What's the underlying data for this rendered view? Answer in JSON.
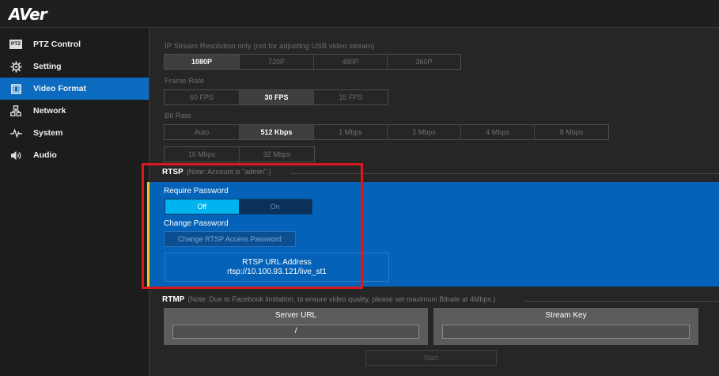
{
  "header": {
    "logo": "AVer"
  },
  "sidebar": {
    "items": [
      {
        "label": "PTZ Control",
        "icon": "ptz-icon",
        "badge": "PTZ"
      },
      {
        "label": "Setting",
        "icon": "gear-icon"
      },
      {
        "label": "Video Format",
        "icon": "film-icon"
      },
      {
        "label": "Network",
        "icon": "network-icon"
      },
      {
        "label": "System",
        "icon": "pulse-icon"
      },
      {
        "label": "Audio",
        "icon": "speaker-icon"
      }
    ],
    "active": "Video Format"
  },
  "resolution": {
    "label": "IP Stream Resolution only (not for adjusting USB video stream)",
    "options": [
      "1080P",
      "720P",
      "480P",
      "360P"
    ],
    "selected": "1080P"
  },
  "frame_rate": {
    "label": "Frame Rate",
    "options": [
      "60 FPS",
      "30 FPS",
      "15 FPS"
    ],
    "selected": "30 FPS"
  },
  "bit_rate": {
    "label": "Bit Rate",
    "row1": [
      "Auto",
      "512 Kbps",
      "1 Mbps",
      "2 Mbps",
      "4 Mbps",
      "8 Mbps"
    ],
    "row2": [
      "16 Mbps",
      "32 Mbps"
    ],
    "selected": "512 Kbps"
  },
  "rtsp": {
    "title": "RTSP",
    "note": "(Note: Account is \"admin\".)",
    "require_password_label": "Require Password",
    "toggle": {
      "off": "Off",
      "on": "On",
      "selected": "Off"
    },
    "change_password_label": "Change Password",
    "change_password_button": "Change RTSP Access Password",
    "url_title": "RTSP URL Address",
    "url_value": "rtsp://10.100.93.121/live_st1"
  },
  "rtmp": {
    "title": "RTMP",
    "note": "(Note: Due to Facebook limitation, to ensure video quality, please set maximum Bitrate at 4Mbps.)",
    "server_url_label": "Server URL",
    "server_url_value": "/",
    "stream_key_label": "Stream Key",
    "stream_key_value": "",
    "start_button": "Start"
  },
  "colors": {
    "accent_blue": "#0463b8",
    "active_sidebar": "#0a6bbf",
    "toggle_on": "#00b4f0",
    "highlight_red": "#d7191f",
    "panel_stripe": "#ffc21a"
  }
}
